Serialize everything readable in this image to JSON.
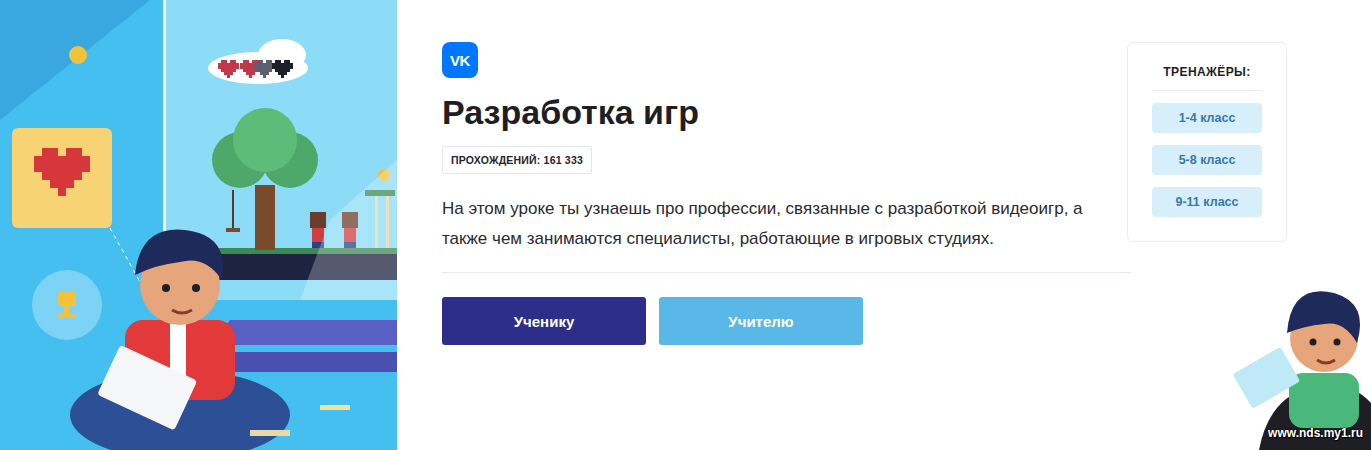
{
  "logo": "VK",
  "title": "Разработка игр",
  "badge": "ПРОХОЖДЕНИЙ: 161 333",
  "description": "На этом уроке ты узнаешь про профессии, связанные с разработкой видеоигр, а также чем занимаются специалисты, работающие в игровых студиях.",
  "buttons": [
    {
      "label": "Ученику",
      "kind": "primary"
    },
    {
      "label": "Учителю",
      "kind": "secondary"
    }
  ],
  "trainers": {
    "title": "ТРЕНАЖЁРЫ:",
    "items": [
      "1-4 класс",
      "5-8 класс",
      "9-11 класс"
    ]
  },
  "watermark": "www.nds.my1.ru"
}
